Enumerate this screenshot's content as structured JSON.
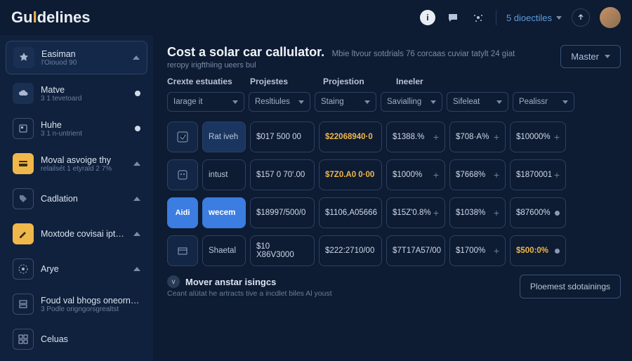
{
  "topbar": {
    "logo_pre": "Gu",
    "logo_accent": "l",
    "logo_post": "delines",
    "dropdown": "5 dioectiles"
  },
  "sidebar": {
    "items": [
      {
        "label": "Easiman",
        "sub": "l'Oiouod 90",
        "ind": "tri"
      },
      {
        "label": "Matve",
        "sub": "3 1 tevetoard",
        "ind": "dot"
      },
      {
        "label": "Huhe",
        "sub": "3 1 n-untrient",
        "ind": "dot"
      },
      {
        "label": "Moval asvoige thy",
        "sub": "relailsét 1 etyrald 2 7%",
        "ind": "tri"
      },
      {
        "label": "Cadlation",
        "sub": "",
        "ind": "tri"
      },
      {
        "label": "Moxtode covisai iptoatsyniackent",
        "sub": "",
        "ind": "tri"
      },
      {
        "label": "Arye",
        "sub": "",
        "ind": "tri"
      },
      {
        "label": "Foud val bhogs oneornvatic",
        "sub": "3 Podle origngorsgrealtst",
        "ind": ""
      },
      {
        "label": "Celuas",
        "sub": "",
        "ind": ""
      }
    ]
  },
  "header": {
    "title": "Cost a solar car callulator.",
    "subtitle_inline": "Mbie ltvour sotdrials 76 corcaas cuviar tatylt 24 giat",
    "subtitle2": "reropy irigfthiing ueers bul",
    "master": "Master"
  },
  "columns": [
    "Crexte estuaties",
    "Projestes",
    "Projestion",
    "Ineeler"
  ],
  "filters": [
    "Iarage it",
    "Resltiules",
    "Staing",
    "Savialling",
    "Sifeleat",
    "Pealissr"
  ],
  "rows": [
    {
      "label": "Rat iveh",
      "c1": "$017 500 00",
      "c2": "$22068940·0",
      "c3": "$1388.%",
      "c4": "$708·A%",
      "c5": "$10000%",
      "dot": false
    },
    {
      "label": "intust",
      "c1": "$157 0 70′.00",
      "c2": "$7Z0.A0 0·00",
      "c3": "$1000%",
      "c4": "$7668%",
      "c5": "$1870001",
      "dot": false
    },
    {
      "label": "wecem",
      "c1": "$18997/500/0",
      "c2": "$1106,A05666",
      "c3": "$15Z'0.8%",
      "c4": "$1038%",
      "c5": "$87600%",
      "dot": true,
      "active": true
    },
    {
      "label": "Shaetal",
      "c1": "$10 X86V3000",
      "c2": "$222:2710/00",
      "c3": "$7T17A57/00",
      "c4": "$1700%",
      "c5": "$500:0%",
      "dot": true,
      "gold5": true
    }
  ],
  "footer": {
    "title": "Mover anstar isingcs",
    "sub": "Ceant alütat he artracts tive a incdlet biles Al youst",
    "button": "Ploemest sdotainings"
  }
}
